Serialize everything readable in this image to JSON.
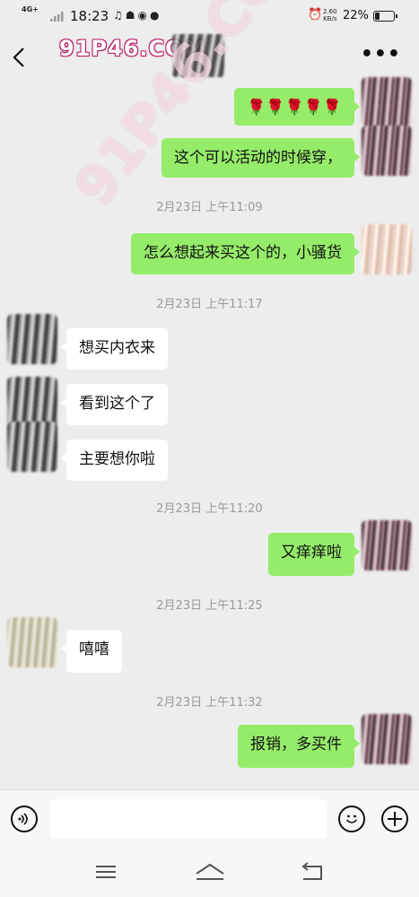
{
  "status_bar": {
    "network": "4G+",
    "time": "18:23",
    "speed_value": "2.60",
    "speed_unit": "KB/s",
    "battery_percent": "22%",
    "battery_level": 0.22
  },
  "header": {
    "back_icon": "chevron-left-icon",
    "more_icon": "more-dots-icon",
    "watermark": "91P46.COM"
  },
  "diagonal_watermark": "91P46.COM",
  "messages": [
    {
      "side": "me",
      "text": "🌹🌹🌹🌹🌹"
    },
    {
      "side": "me",
      "text": "这个可以活动的时候穿，"
    },
    {
      "type": "time",
      "text": "2月23日 上午11:09"
    },
    {
      "side": "me",
      "text": "怎么想起来买这个的，小骚货"
    },
    {
      "type": "time",
      "text": "2月23日 上午11:17"
    },
    {
      "side": "them",
      "text": "想买内衣来"
    },
    {
      "side": "them",
      "text": "看到这个了"
    },
    {
      "side": "them",
      "text": "主要想你啦"
    },
    {
      "type": "time",
      "text": "2月23日 上午11:20"
    },
    {
      "side": "me",
      "text": "又痒痒啦"
    },
    {
      "type": "time",
      "text": "2月23日 上午11:25"
    },
    {
      "side": "them",
      "text": "嘻嘻"
    },
    {
      "type": "time",
      "text": "2月23日 上午11:32"
    },
    {
      "side": "me",
      "text": "报销，多买件"
    }
  ],
  "input_bar": {
    "voice_icon": "voice-icon",
    "input_value": "",
    "emoji_icon": "emoji-icon",
    "plus_icon": "plus-icon"
  },
  "nav_bar": {
    "menu_icon": "menu-icon",
    "home_icon": "home-icon",
    "back_icon": "back-arrow-icon"
  },
  "colors": {
    "background": "#ededed",
    "my_bubble": "#95ec69",
    "their_bubble": "#ffffff",
    "timestamp": "#9a9a9a"
  }
}
